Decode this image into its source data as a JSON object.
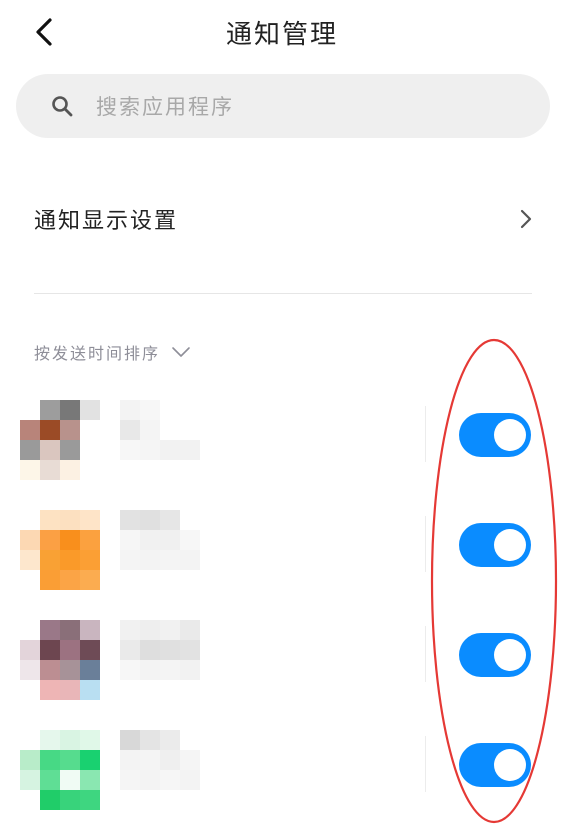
{
  "header": {
    "title": "通知管理"
  },
  "search": {
    "placeholder": "搜索应用程序"
  },
  "settings": {
    "label": "通知显示设置"
  },
  "sort": {
    "label": "按发送时间排序"
  },
  "apps": [
    {
      "icon_pixels": [
        "#ffffff",
        "#9d9d9d",
        "#787878",
        "#e2e2e2",
        "#b8847a",
        "#9b4b26",
        "#b8928c",
        "#ffffff",
        "#9a9a9a",
        "#dac6bf",
        "#9a9a9a",
        "#ffffff",
        "#fdf6e8",
        "#e8dcd5",
        "#fcf1e3",
        "#ffffff"
      ],
      "name_pixels": [
        "#f3f3f3",
        "#f7f7f7",
        "#ffffff",
        "#ffffff",
        "#e8e8e8",
        "#f4f4f4",
        "#ffffff",
        "#ffffff",
        "#f7f7f7",
        "#f5f5f5",
        "#f2f2f2",
        "#f2f2f2"
      ],
      "enabled": true
    },
    {
      "icon_pixels": [
        "#ffffff",
        "#fde2c2",
        "#fce0c0",
        "#fee4c8",
        "#fcd8b3",
        "#fba044",
        "#f98f1c",
        "#fba13f",
        "#fde7cd",
        "#f9a134",
        "#fa9a29",
        "#fb9f34",
        "#ffffff",
        "#fa9e35",
        "#fba446",
        "#fbac50"
      ],
      "name_pixels": [
        "#e2e2e2",
        "#e0e0e0",
        "#e6e6e6",
        "#ffffff",
        "#f6f6f6",
        "#f1f1f1",
        "#f0f0f0",
        "#f7f7f7",
        "#f4f4f4",
        "#f3f3f3",
        "#f4f4f4",
        "#f3f3f3"
      ],
      "enabled": true
    },
    {
      "icon_pixels": [
        "#ffffff",
        "#9a7888",
        "#8a6f79",
        "#c9b5bf",
        "#e3d4da",
        "#6d4650",
        "#9c7281",
        "#6e4b56",
        "#eee6ea",
        "#bc8e92",
        "#a79298",
        "#6a7f99",
        "#ffffff",
        "#eeb5b5",
        "#e9b6b8",
        "#b9dff2"
      ],
      "name_pixels": [
        "#f1f1f1",
        "#eeeeee",
        "#f1f1f1",
        "#eaeaea",
        "#eaeaea",
        "#dedede",
        "#e0e0e0",
        "#e2e2e2",
        "#f7f7f7",
        "#f3f3f3",
        "#f4f4f4",
        "#f2f2f2"
      ],
      "enabled": true
    },
    {
      "icon_pixels": [
        "#ffffff",
        "#e5f7ec",
        "#d9f4e3",
        "#e0f8e8",
        "#b8ecc9",
        "#47d985",
        "#56dc8e",
        "#19d170",
        "#d6f3e1",
        "#5fde95",
        "#f0fbf4",
        "#8ae7b1",
        "#ffffff",
        "#20cd69",
        "#38d37b",
        "#3ed680"
      ],
      "name_pixels": [
        "#d8d8d8",
        "#e4e4e4",
        "#ebebeb",
        "#ffffff",
        "#f3f3f3",
        "#f4f4f4",
        "#efefef",
        "#f5f5f5",
        "#f5f5f5",
        "#f3f3f3",
        "#f6f6f6",
        "#f3f3f3"
      ],
      "enabled": true
    }
  ]
}
